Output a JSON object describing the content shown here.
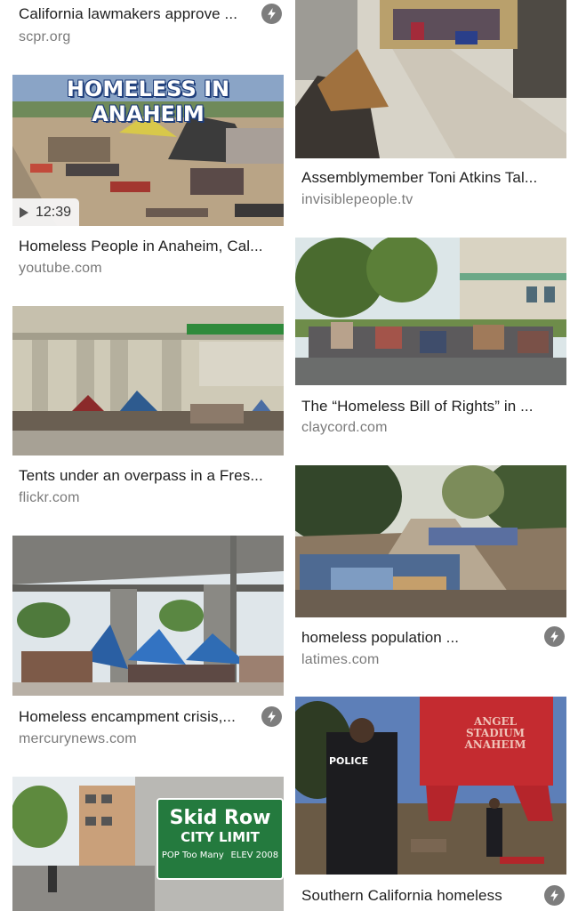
{
  "left_column": [
    {
      "title": "California lawmakers approve ...",
      "source": "scpr.org",
      "amp": true
    },
    {
      "title": "Homeless People in Anaheim, Cal...",
      "source": "youtube.com",
      "amp": false,
      "duration": "12:39",
      "overlay_text": "HOMELESS IN ANAHEIM"
    },
    {
      "title": "Tents under an overpass in a Fres...",
      "source": "flickr.com",
      "amp": false
    },
    {
      "title": "Homeless encampment crisis,...",
      "source": "mercurynews.com",
      "amp": true
    },
    {
      "sign_line1": "Skid Row",
      "sign_line2": "CITY LIMIT",
      "sign_line3": "POP Too Many",
      "sign_line4": "ELEV 2008"
    }
  ],
  "right_column": [
    {
      "title": "Assemblymember Toni Atkins Tal...",
      "source": "invisiblepeople.tv",
      "amp": false
    },
    {
      "title": "The “Homeless Bill of Rights” in ...",
      "source": "claycord.com",
      "amp": false
    },
    {
      "title": "homeless population ...",
      "source": "latimes.com",
      "amp": true
    },
    {
      "title": "Southern California homeless",
      "source": "",
      "amp": true,
      "police_text": "POLICE",
      "stadium_text": "ANGEL STADIUM ANAHEIM"
    }
  ],
  "colors": {
    "amp_badge": "#7d7d7d",
    "title": "#1f1f1f",
    "source": "#7a7a7a"
  },
  "icons": {
    "amp": "lightning-bolt-icon",
    "play": "play-icon"
  }
}
